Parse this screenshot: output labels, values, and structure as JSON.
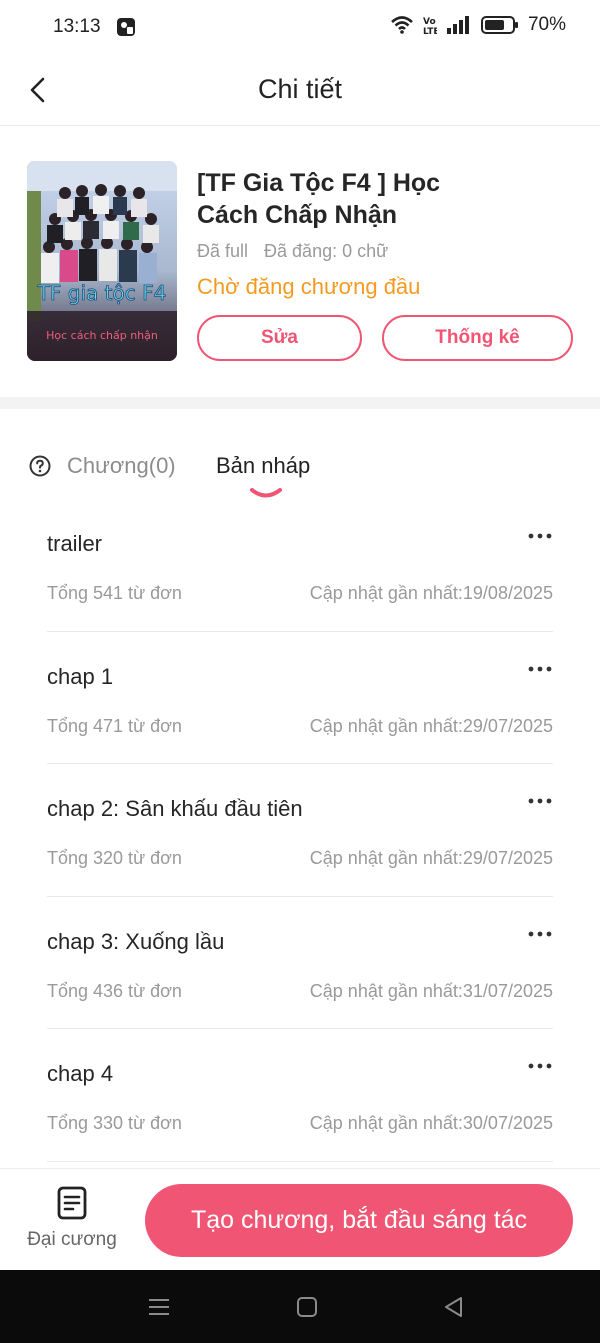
{
  "status_bar": {
    "time": "13:13",
    "battery_percent": "70%",
    "icons": [
      "app-notification-icon",
      "wifi-icon",
      "volte-icon",
      "signal-icon",
      "battery-icon"
    ]
  },
  "header": {
    "title": "Chi tiết",
    "back_icon": "chevron-left-icon"
  },
  "book": {
    "title_line1": "[TF Gia Tộc F4 ] Học",
    "title_line2": "Cách Chấp Nhận",
    "full_status": "Đã full",
    "posted": "Đã đăng: 0 chữ",
    "status": "Chờ đăng chương đầu",
    "edit_label": "Sửa",
    "stats_label": "Thống kê",
    "cover_title": "TF gia tộc F4",
    "cover_subtitle": "Học cách chấp nhận"
  },
  "tabs": {
    "chapters_label": "Chương(0)",
    "drafts_label": "Bản nháp",
    "active": "drafts"
  },
  "drafts": [
    {
      "title": "trailer",
      "words": "Tổng 541 từ đơn",
      "updated": "Cập nhật gần nhất:19/08/2025"
    },
    {
      "title": "chap 1",
      "words": "Tổng 471 từ đơn",
      "updated": "Cập nhật gần nhất:29/07/2025"
    },
    {
      "title": "chap 2: Sân khấu đầu tiên",
      "words": "Tổng 320 từ đơn",
      "updated": "Cập nhật gần nhất:29/07/2025"
    },
    {
      "title": "chap 3: Xuống lầu",
      "words": "Tổng 436 từ đơn",
      "updated": "Cập nhật gần nhất:31/07/2025"
    },
    {
      "title": "chap 4",
      "words": "Tổng 330 từ đơn",
      "updated": "Cập nhật gần nhất:30/07/2025"
    }
  ],
  "bottom_bar": {
    "outline_label": "Đại cương",
    "create_label": "Tạo chương, bắt đầu sáng tác"
  },
  "colors": {
    "accent": "#f05674",
    "status_orange": "#f39a21",
    "muted_text": "#9a9a9a"
  }
}
